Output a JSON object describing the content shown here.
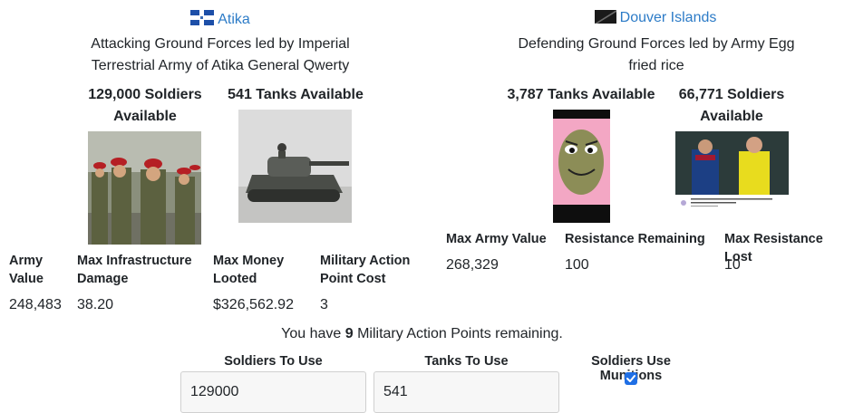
{
  "attacker": {
    "nation_name": "Atika",
    "flag_icon": "atika-flag-icon",
    "description": "Attacking Ground Forces led by Imperial Terrestrial Army of Atika General Qwerty",
    "soldiers_available": "129,000 Soldiers Available",
    "tanks_available": "541 Tanks Available",
    "stats": [
      {
        "label": "Army Value",
        "value": "248,483"
      },
      {
        "label": "Max Infrastructure Damage",
        "value": "38.20"
      },
      {
        "label": "Max Money Looted",
        "value": "$326,562.92"
      },
      {
        "label": "Military Action Point Cost",
        "value": "3"
      }
    ]
  },
  "defender": {
    "nation_name": "Douver Islands",
    "flag_icon": "douver-islands-flag-icon",
    "description": "Defending Ground Forces led by Army Egg fried rice",
    "tanks_available": "3,787 Tanks Available",
    "soldiers_available": "66,771 Soldiers Available",
    "stats": [
      {
        "label": "Max Army Value",
        "value": "268,329"
      },
      {
        "label": "Resistance Remaining",
        "value": "100"
      },
      {
        "label": "Max Resistance Lost",
        "value": "10"
      }
    ],
    "referee_image_caption": "10 WORST REFEREE MISTAKES IN FOOTBALL"
  },
  "map_remaining": {
    "prefix": "You have ",
    "count": "9",
    "suffix": " Military Action Points remaining."
  },
  "form": {
    "soldiers_label": "Soldiers To Use",
    "soldiers_value": "129000",
    "tanks_label": "Tanks To Use",
    "tanks_value": "541",
    "munitions_label": "Soldiers Use Munitions",
    "munitions_checked": true
  },
  "colors": {
    "link": "#2c7bc7",
    "checkbox": "#1f6fe5"
  }
}
